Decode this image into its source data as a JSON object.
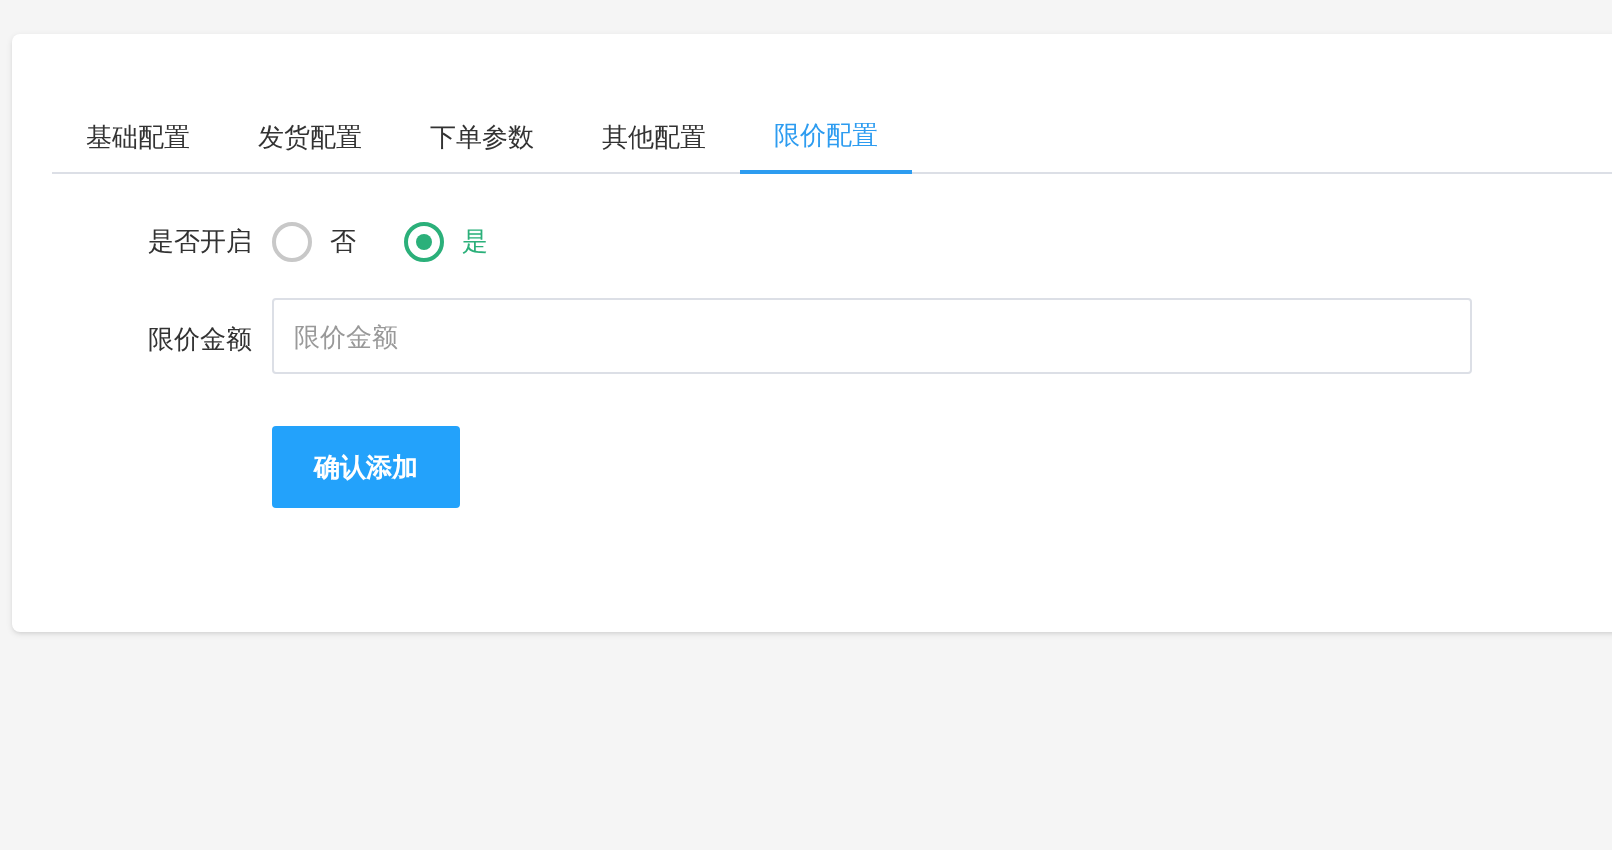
{
  "tabs": [
    {
      "label": "基础配置",
      "selected": false
    },
    {
      "label": "发货配置",
      "selected": false
    },
    {
      "label": "下单参数",
      "selected": false
    },
    {
      "label": "其他配置",
      "selected": false
    },
    {
      "label": "限价配置",
      "selected": true
    }
  ],
  "form": {
    "enable": {
      "label": "是否开启",
      "options": [
        {
          "label": "否",
          "selected": false
        },
        {
          "label": "是",
          "selected": true
        }
      ]
    },
    "amount": {
      "label": "限价金额",
      "placeholder": "限价金额"
    },
    "submit": "确认添加"
  }
}
